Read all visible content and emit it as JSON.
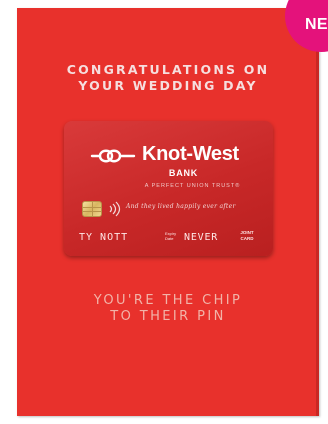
{
  "product": {
    "headline": [
      "CONGRATULATIONS ON",
      "YOUR WEDDING DAY"
    ],
    "punchline": [
      "YOU'RE THE CHIP",
      "TO THEIR PIN"
    ],
    "badge": "NEW",
    "colors": {
      "card": "#e8312c",
      "badge": "#e4127b",
      "headline_text": "#f6dede",
      "punchline_text": "#f2b3a8"
    }
  },
  "bank_card": {
    "logo_icon": "knot-icon",
    "brand_name": "Knot-West",
    "brand_sub": "BANK",
    "tagline": "A PERFECT UNION TRUST®",
    "motto": "And they lived happily ever after",
    "chip_icon": "chip-icon",
    "contactless_icon": "contactless-icon",
    "holder_name": "TY NOTT",
    "expiry_label": [
      "Expiry",
      "Date"
    ],
    "expiry_value": "NEVER",
    "card_type": [
      "JOINT",
      "CARD"
    ]
  }
}
